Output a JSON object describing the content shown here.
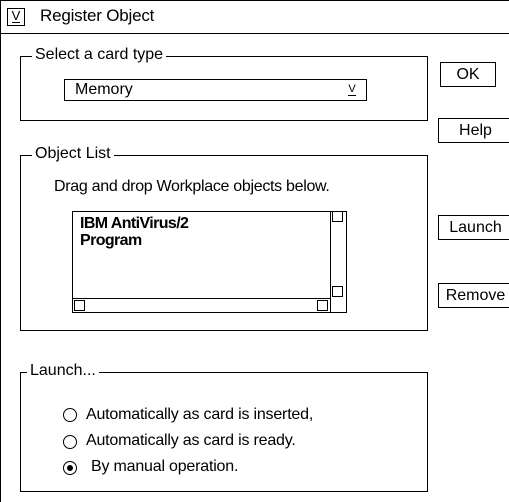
{
  "window": {
    "title": "Register Object",
    "system_menu_glyph": "V"
  },
  "card_type": {
    "legend": "Select a card type",
    "selected": "Memory",
    "dropdown_glyph": "V"
  },
  "buttons": {
    "ok": "OK",
    "help": "Help",
    "launch": "Launch",
    "remove": "Remove"
  },
  "object_list": {
    "legend": "Object List",
    "instruction": "Drag and drop Workplace objects below.",
    "items": [
      "IBM AntiVirus/2",
      "Program"
    ]
  },
  "launch": {
    "legend": "Launch...",
    "options": [
      {
        "label": "Automatically as card is inserted,",
        "selected": false
      },
      {
        "label": "Automatically as card is ready.",
        "selected": false
      },
      {
        "label": "By manual operation.",
        "selected": true
      }
    ]
  }
}
